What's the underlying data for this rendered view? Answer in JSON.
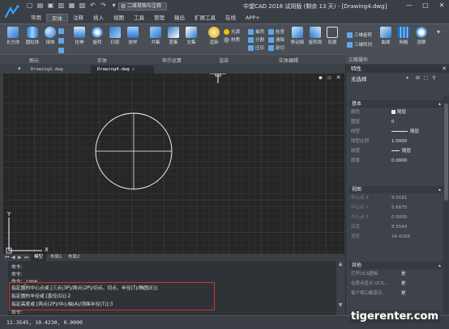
{
  "title_bar": {
    "workspace": "二维草图与注释",
    "title": "中望CAD 2018 试用版 (剩余 13 天) - [Drawing4.dwg]",
    "minimize": "—",
    "maximize": "□",
    "close": "✕"
  },
  "menu_tabs": [
    "常用",
    "实体",
    "注释",
    "插入",
    "视图",
    "工具",
    "管理",
    "输出",
    "扩展工具",
    "在线",
    "APP+"
  ],
  "active_menu_tab": "实体",
  "ribbon": {
    "buttons": [
      "长方体",
      "圆柱体",
      "球体",
      "拉伸",
      "旋转",
      "扫掠",
      "放样",
      "并集",
      "差集",
      "交集",
      "渲染",
      "轮廓",
      "剖切",
      "移动面",
      "旋转面",
      "轮廓"
    ],
    "small": {
      "light": "光源",
      "material": "材质",
      "extract": "抽壳",
      "separate": "分割",
      "press": "压印",
      "clean": "清除",
      "check": "检查",
      "section": "剖切",
      "slice": "截面",
      "3d_rotate": "三维旋转",
      "3d_array": "三维阵列",
      "surface": "曲面",
      "mesh": "网格",
      "view": "观察"
    },
    "panels": [
      "图元",
      "实体",
      "布尔运算",
      "渲染",
      "实体编辑",
      "三维操作"
    ]
  },
  "doc_tabs": [
    "Drawing1.dwg",
    "Drawing4.dwg"
  ],
  "active_doc": "Drawing4.dwg",
  "layout_tabs": [
    "模型",
    "布局1",
    "布局2"
  ],
  "command": {
    "lines": [
      "命令:",
      "命令:",
      "命令: _cone",
      "指定圆的中心点或 [三点(3P)/两点(2P)/切点、切点、半径(T)/椭圆(E)]:",
      "指定圆的半径或 [直径(D)]:2",
      "指定高度或 [两点(2P)/中心轴(A)/顶面半径(T)]:3",
      "命令:"
    ]
  },
  "status": {
    "coords": "11.3545, 10.4230, 0.0000"
  },
  "canvas_ucs": {
    "x": "X",
    "y": "Y"
  },
  "properties": {
    "title": "特性",
    "selection": "无选择",
    "sections": {
      "basic": "基本",
      "view": "视图",
      "other": "其他"
    },
    "basic_rows": [
      {
        "key": "颜色",
        "value": "随层"
      },
      {
        "key": "图层",
        "value": "0"
      },
      {
        "key": "线型",
        "value": "随层"
      },
      {
        "key": "线型比例",
        "value": "1.0000"
      },
      {
        "key": "线宽",
        "value": "随层"
      },
      {
        "key": "厚度",
        "value": "0.0000"
      }
    ],
    "view_rows": [
      {
        "key": "中心点 X",
        "value": "9.0181"
      },
      {
        "key": "中心点 Y",
        "value": "5.6875"
      },
      {
        "key": "中心点 Z",
        "value": "0.0000"
      },
      {
        "key": "高度",
        "value": "8.5544"
      },
      {
        "key": "宽度",
        "value": "24.4168"
      }
    ],
    "other_rows": [
      {
        "key": "打开UCS图标",
        "value": "是"
      },
      {
        "key": "在原点显示 UCS...",
        "value": "是"
      },
      {
        "key": "每个视口都显示...",
        "value": "是"
      }
    ]
  },
  "watermark": "tigerenter.com",
  "colors": {
    "ucs": "#ffffff",
    "circle": "#ffffff",
    "highlight": "#d0352b",
    "accent": "#5fa8e8"
  }
}
